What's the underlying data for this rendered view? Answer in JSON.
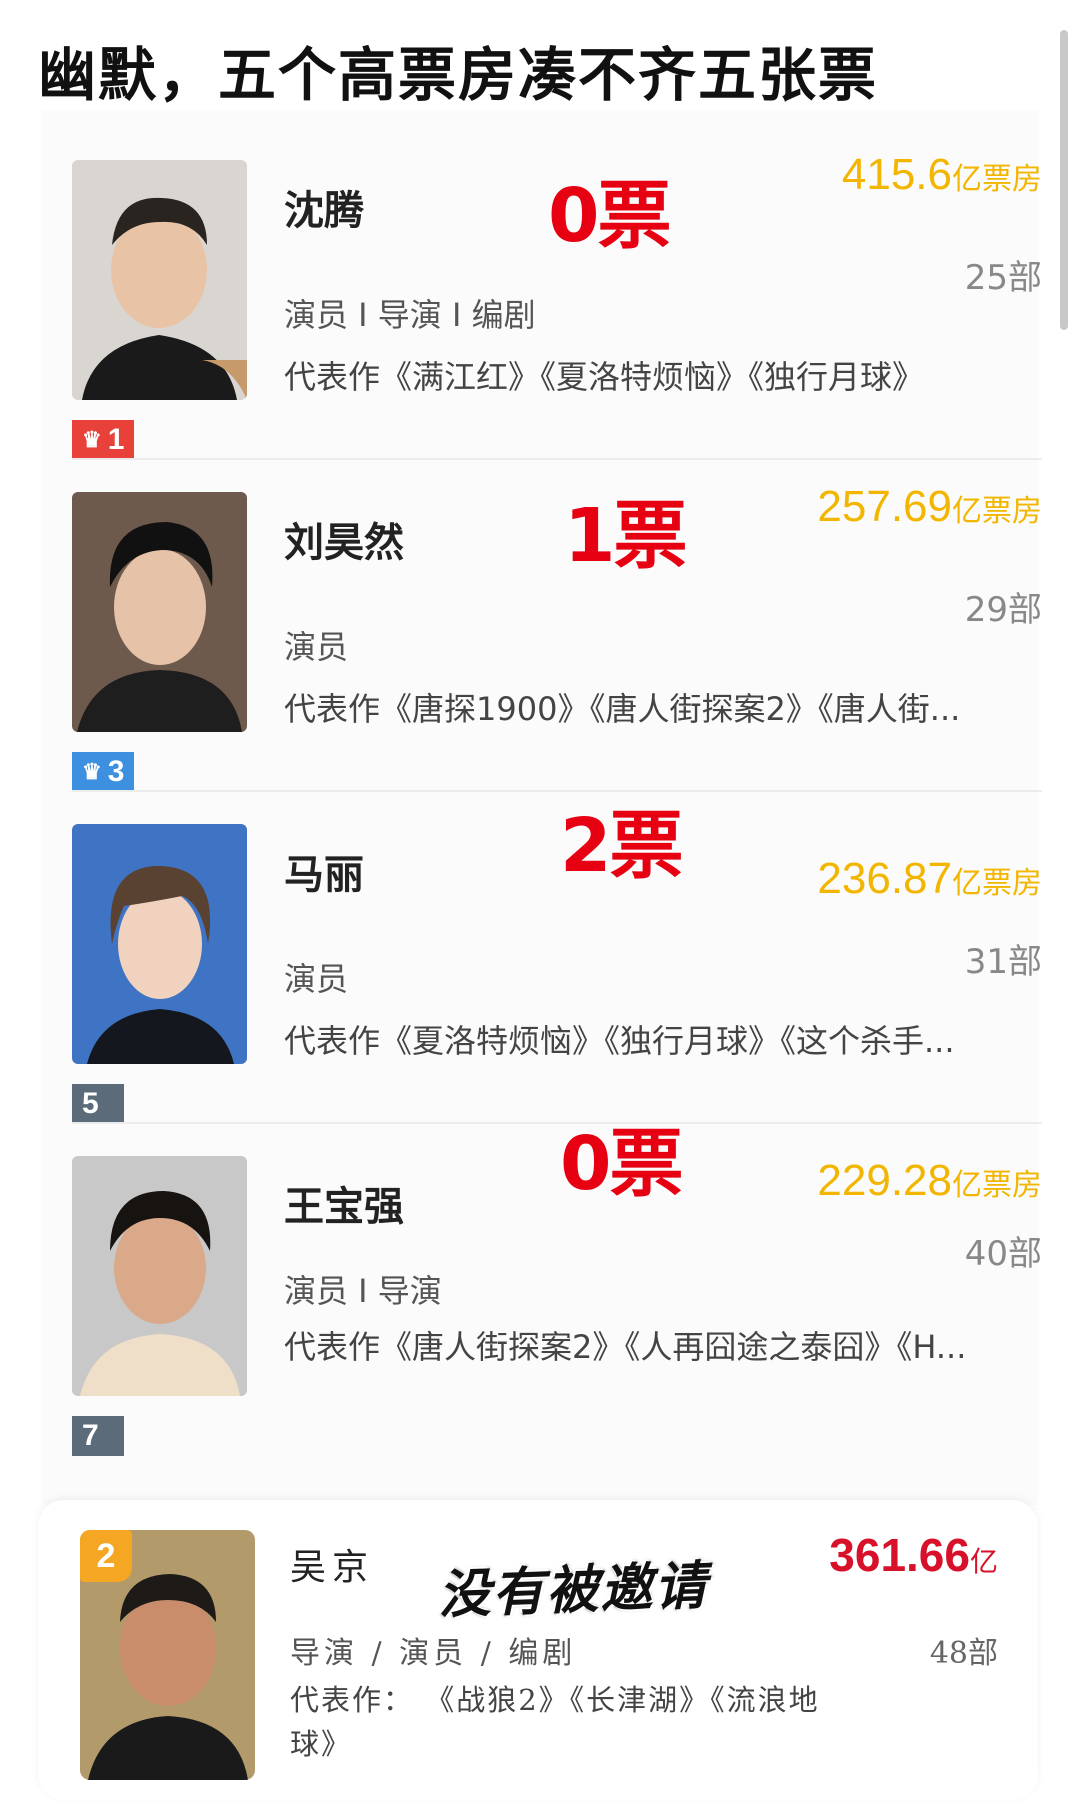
{
  "headline": "幽默，五个高票房凑不齐五张票",
  "colors": {
    "votes": "#e60012",
    "boxoffice": "#f2b600",
    "bottom_boxoffice": "#d8112b"
  },
  "cards": [
    {
      "name": "沈腾",
      "rank": "1",
      "rank_color": "#e8413a",
      "crown": true,
      "votes": "0票",
      "boxoffice_num": "415.6",
      "boxoffice_unit": "亿票房",
      "count": "25部",
      "role": "演员 I 导演 I 编剧",
      "works": "代表作《满江红》《夏洛特烦恼》《独行月球》"
    },
    {
      "name": "刘昊然",
      "rank": "3",
      "rank_color": "#3d8fe0",
      "crown": true,
      "votes": "1票",
      "boxoffice_num": "257.69",
      "boxoffice_unit": "亿票房",
      "count": "29部",
      "role": "演员",
      "works": "代表作《唐探1900》《唐人街探案2》《唐人街..."
    },
    {
      "name": "马丽",
      "rank": "5",
      "rank_color": "#5b6b7a",
      "crown": false,
      "votes": "2票",
      "boxoffice_num": "236.87",
      "boxoffice_unit": "亿票房",
      "count": "31部",
      "role": "演员",
      "works": "代表作《夏洛特烦恼》《独行月球》《这个杀手..."
    },
    {
      "name": "王宝强",
      "rank": "7",
      "rank_color": "#5b6b7a",
      "crown": false,
      "votes": "0票",
      "boxoffice_num": "229.28",
      "boxoffice_unit": "亿票房",
      "count": "40部",
      "role": "演员 I 导演",
      "works": "代表作《唐人街探案2》《人再囧途之泰囧》《H..."
    }
  ],
  "bottom": {
    "name": "吴京",
    "rank": "2",
    "stamp": "没有被邀请",
    "boxoffice_num": "361.66",
    "boxoffice_unit": "亿",
    "role": "导演 / 演员 / 编剧",
    "count": "48部",
    "works": "代表作： 《战狼2》《长津湖》《流浪地球》"
  }
}
